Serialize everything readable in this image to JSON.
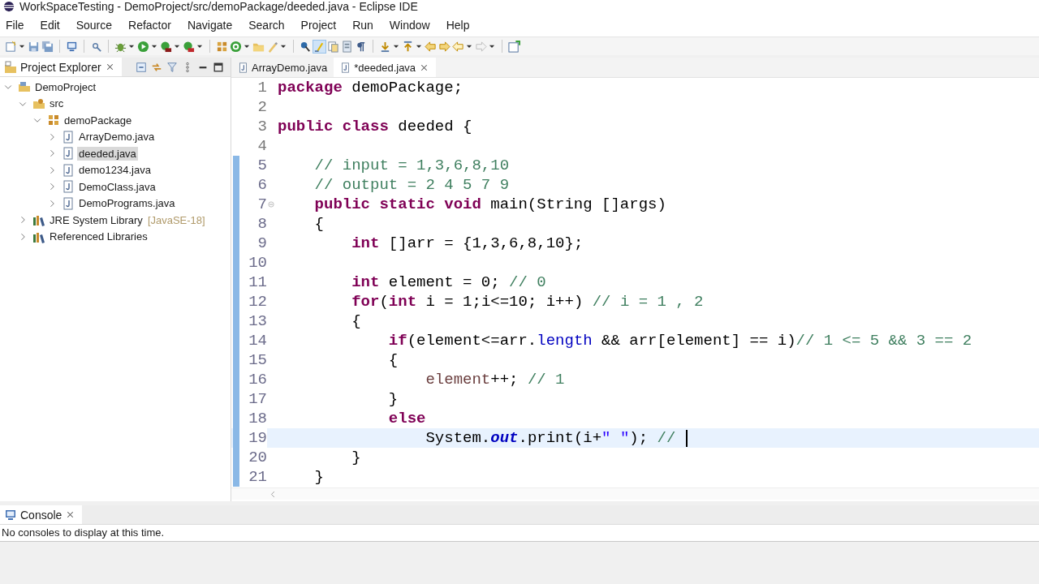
{
  "window": {
    "title": "WorkSpaceTesting - DemoProject/src/demoPackage/deeded.java - Eclipse IDE"
  },
  "menu": [
    "File",
    "Edit",
    "Source",
    "Refactor",
    "Navigate",
    "Search",
    "Project",
    "Run",
    "Window",
    "Help"
  ],
  "project_explorer": {
    "title": "Project Explorer",
    "items": [
      {
        "label": "DemoProject",
        "kind": "project",
        "expanded": true,
        "selected": false,
        "children": [
          {
            "label": "src",
            "kind": "source",
            "expanded": true,
            "selected": false,
            "children": [
              {
                "label": "demoPackage",
                "kind": "package",
                "expanded": true,
                "selected": false,
                "children": [
                  {
                    "label": "ArrayDemo.java",
                    "kind": "file",
                    "expanded": false,
                    "selected": false
                  },
                  {
                    "label": "deeded.java",
                    "kind": "file",
                    "expanded": false,
                    "selected": true
                  },
                  {
                    "label": "demo1234.java",
                    "kind": "file",
                    "expanded": false,
                    "selected": false
                  },
                  {
                    "label": "DemoClass.java",
                    "kind": "file",
                    "expanded": false,
                    "selected": false
                  },
                  {
                    "label": "DemoPrograms.java",
                    "kind": "file",
                    "expanded": false,
                    "selected": false
                  }
                ]
              }
            ]
          },
          {
            "label": "JRE System Library",
            "decoration": "[JavaSE-18]",
            "kind": "library",
            "expanded": false,
            "selected": false
          },
          {
            "label": "Referenced Libraries",
            "kind": "library",
            "expanded": false,
            "selected": false
          }
        ]
      }
    ]
  },
  "editor": {
    "tabs": [
      {
        "label": "ArrayDemo.java",
        "selected": false
      },
      {
        "label": "*deeded.java",
        "selected": true
      }
    ],
    "lines": [
      {
        "number": "1",
        "changed": false,
        "current": false,
        "tokens": [
          {
            "kind": "keyword",
            "text": "package"
          },
          {
            "kind": "plain",
            "text": " demoPackage;"
          }
        ]
      },
      {
        "number": "2",
        "changed": false,
        "current": false
      },
      {
        "number": "3",
        "changed": false,
        "current": false,
        "tokens": [
          {
            "kind": "keyword",
            "text": "public class"
          },
          {
            "kind": "plain",
            "text": " deeded {"
          }
        ]
      },
      {
        "number": "4",
        "changed": false,
        "current": false
      },
      {
        "number": "5",
        "changed": true,
        "current": false,
        "tokens": [
          {
            "kind": "comment",
            "text": "    // input = 1,3,6,8,10"
          }
        ]
      },
      {
        "number": "6",
        "changed": true,
        "current": false,
        "tokens": [
          {
            "kind": "comment",
            "text": "    // output = 2 4 5 7 9"
          }
        ]
      },
      {
        "number": "7",
        "changed": true,
        "current": false,
        "foldable": true,
        "tokens": [
          {
            "kind": "keyword",
            "text": "    public static void"
          },
          {
            "kind": "plain",
            "text": " main(String []args)"
          }
        ]
      },
      {
        "number": "8",
        "changed": true,
        "current": false,
        "tokens": [
          {
            "kind": "plain",
            "text": "    {"
          }
        ]
      },
      {
        "number": "9",
        "changed": true,
        "current": false,
        "tokens": [
          {
            "kind": "keyword",
            "text": "        int"
          },
          {
            "kind": "plain",
            "text": " []arr = {1,3,6,8,10};"
          }
        ]
      },
      {
        "number": "10",
        "changed": true,
        "current": false
      },
      {
        "number": "11",
        "changed": true,
        "current": false,
        "tokens": [
          {
            "kind": "keyword",
            "text": "        int"
          },
          {
            "kind": "plain",
            "text": " element = 0; "
          },
          {
            "kind": "comment",
            "text": "// 0"
          }
        ]
      },
      {
        "number": "12",
        "changed": true,
        "current": false,
        "tokens": [
          {
            "kind": "keyword",
            "text": "        for"
          },
          {
            "kind": "plain",
            "text": "("
          },
          {
            "kind": "keyword",
            "text": "int"
          },
          {
            "kind": "plain",
            "text": " i = 1;i<=10; i++) "
          },
          {
            "kind": "comment",
            "text": "// i = 1 , 2"
          }
        ]
      },
      {
        "number": "13",
        "changed": true,
        "current": false,
        "tokens": [
          {
            "kind": "plain",
            "text": "        {"
          }
        ]
      },
      {
        "number": "14",
        "changed": true,
        "current": false,
        "tokens": [
          {
            "kind": "keyword",
            "text": "            if"
          },
          {
            "kind": "plain",
            "text": "(element<=arr."
          },
          {
            "kind": "field",
            "text": "length"
          },
          {
            "kind": "plain",
            "text": " && arr[element] == i)"
          },
          {
            "kind": "comment",
            "text": "// 1 <= 5 && 3 == 2"
          }
        ]
      },
      {
        "number": "15",
        "changed": true,
        "current": false,
        "tokens": [
          {
            "kind": "plain",
            "text": "            {"
          }
        ]
      },
      {
        "number": "16",
        "changed": true,
        "current": false,
        "tokens": [
          {
            "kind": "local",
            "text": "                element"
          },
          {
            "kind": "plain",
            "text": "++; "
          },
          {
            "kind": "comment",
            "text": "// 1"
          }
        ]
      },
      {
        "number": "17",
        "changed": true,
        "current": false,
        "tokens": [
          {
            "kind": "plain",
            "text": "            }"
          }
        ]
      },
      {
        "number": "18",
        "changed": true,
        "current": false,
        "tokens": [
          {
            "kind": "keyword",
            "text": "            else"
          }
        ]
      },
      {
        "number": "19",
        "changed": true,
        "current": true,
        "tokens": [
          {
            "kind": "plain",
            "text": "                System."
          },
          {
            "kind": "static",
            "text": "out"
          },
          {
            "kind": "plain",
            "text": ".print(i+"
          },
          {
            "kind": "string",
            "text": "\" \""
          },
          {
            "kind": "plain",
            "text": "); "
          },
          {
            "kind": "comment",
            "text": "// "
          }
        ]
      },
      {
        "number": "20",
        "changed": true,
        "current": false,
        "tokens": [
          {
            "kind": "plain",
            "text": "        }"
          }
        ]
      },
      {
        "number": "21",
        "changed": true,
        "current": false,
        "tokens": [
          {
            "kind": "plain",
            "text": "    }"
          }
        ]
      }
    ]
  },
  "console": {
    "title": "Console",
    "message": "No consoles to display at this time."
  }
}
